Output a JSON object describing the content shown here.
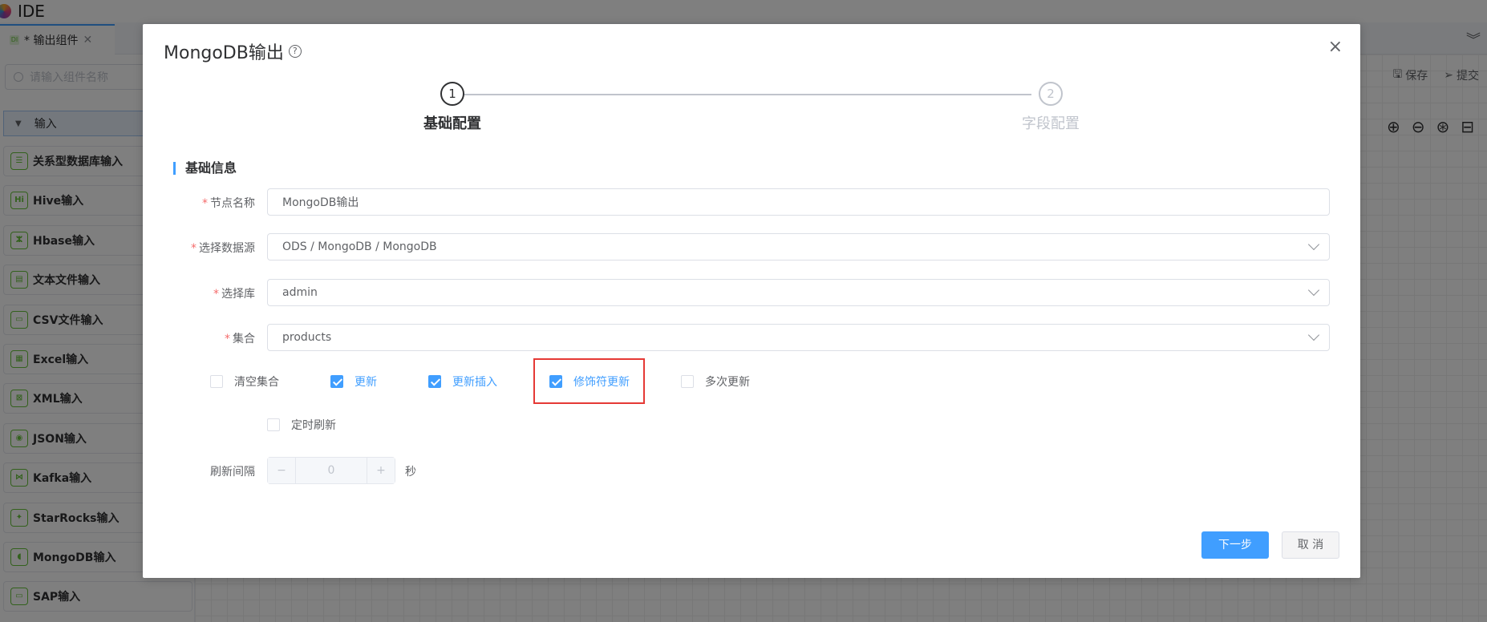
{
  "app": {
    "title": "IDE"
  },
  "tab": {
    "label": "* 输出组件",
    "icon_text": "DI"
  },
  "sidebar": {
    "search_placeholder": "请输入组件名称",
    "group_label": "输入",
    "items": [
      {
        "label": "关系型数据库输入",
        "icon": "☰"
      },
      {
        "label": "Hive输入",
        "icon": "Hi"
      },
      {
        "label": "Hbase输入",
        "icon": "ⵣ"
      },
      {
        "label": "文本文件输入",
        "icon": "▤"
      },
      {
        "label": "CSV文件输入",
        "icon": "▭"
      },
      {
        "label": "Excel输入",
        "icon": "▦"
      },
      {
        "label": "XML输入",
        "icon": "⊠"
      },
      {
        "label": "JSON输入",
        "icon": "◉"
      },
      {
        "label": "Kafka输入",
        "icon": "⋈"
      },
      {
        "label": "StarRocks输入",
        "icon": "✦"
      },
      {
        "label": "MongoDB输入",
        "icon": "◖"
      },
      {
        "label": "SAP输入",
        "icon": "▭"
      }
    ]
  },
  "toolbar": {
    "save_label": "保存",
    "submit_label": "提交"
  },
  "dialog": {
    "title": "MongoDB输出",
    "close": "×",
    "steps": [
      {
        "num": "1",
        "label": "基础配置",
        "active": true
      },
      {
        "num": "2",
        "label": "字段配置",
        "active": false
      }
    ],
    "section_title": "基础信息",
    "fields": {
      "node_name": {
        "label": "节点名称",
        "value": "MongoDB输出"
      },
      "datasource": {
        "label": "选择数据源",
        "value": "ODS / MongoDB / MongoDB"
      },
      "database": {
        "label": "选择库",
        "value": "admin"
      },
      "collection": {
        "label": "集合",
        "value": "products"
      }
    },
    "checkboxes": [
      {
        "label": "清空集合",
        "checked": false
      },
      {
        "label": "更新",
        "checked": true
      },
      {
        "label": "更新插入",
        "checked": true
      },
      {
        "label": "修饰符更新",
        "checked": true
      },
      {
        "label": "多次更新",
        "checked": false
      },
      {
        "label": "定时刷新",
        "checked": false
      }
    ],
    "refresh": {
      "label": "刷新间隔",
      "value": "0",
      "unit": "秒",
      "minus": "−",
      "plus": "+"
    },
    "buttons": {
      "next": "下一步",
      "cancel": "取 消"
    }
  }
}
